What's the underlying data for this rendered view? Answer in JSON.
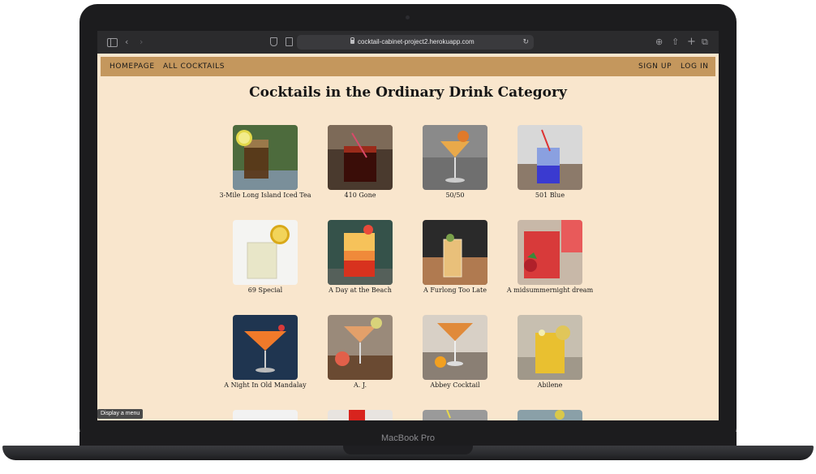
{
  "browser": {
    "url": "cocktail-cabinet-project2.herokuapp.com"
  },
  "nav": {
    "homepage": "HOMEPAGE",
    "all_cocktails": "ALL COCKTAILS",
    "sign_up": "SIGN UP",
    "log_in": "LOG IN"
  },
  "page": {
    "title": "Cocktails in the Ordinary Drink Category"
  },
  "cocktails": [
    {
      "name": "3-Mile Long Island Iced Tea"
    },
    {
      "name": "410 Gone"
    },
    {
      "name": "50/50"
    },
    {
      "name": "501 Blue"
    },
    {
      "name": "69 Special"
    },
    {
      "name": "A Day at the Beach"
    },
    {
      "name": "A Furlong Too Late"
    },
    {
      "name": "A midsummernight dream"
    },
    {
      "name": "A Night In Old Mandalay"
    },
    {
      "name": "A. J."
    },
    {
      "name": "Abbey Cocktail"
    },
    {
      "name": "Abilene"
    }
  ],
  "tooltip": "Display a menu",
  "device": {
    "model": "MacBook Pro"
  }
}
